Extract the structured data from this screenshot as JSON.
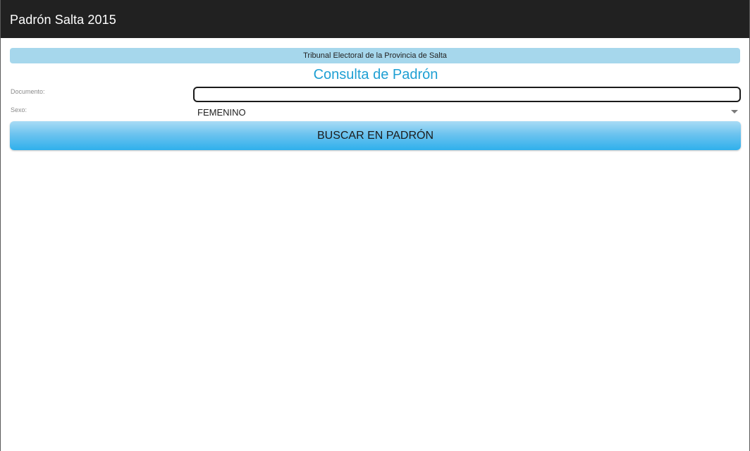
{
  "app_bar": {
    "title": "Padrón Salta 2015"
  },
  "banner": {
    "text": "Tribunal Electoral de la Provincia de Salta"
  },
  "heading": "Consulta de Padrón",
  "form": {
    "documento_label": "Documento:",
    "documento_value": "",
    "sexo_label": "Sexo:",
    "sexo_selected": "FEMENINO"
  },
  "search_button": {
    "label": "BUSCAR EN PADRÓN"
  },
  "colors": {
    "action_bar": "#212121",
    "banner": "#a6d7ec",
    "heading": "#1e9fd3",
    "button_top": "#a9dcf5",
    "button_bottom": "#2fb0ec"
  },
  "icons": {
    "select_indicator": "chevron-down-icon"
  }
}
